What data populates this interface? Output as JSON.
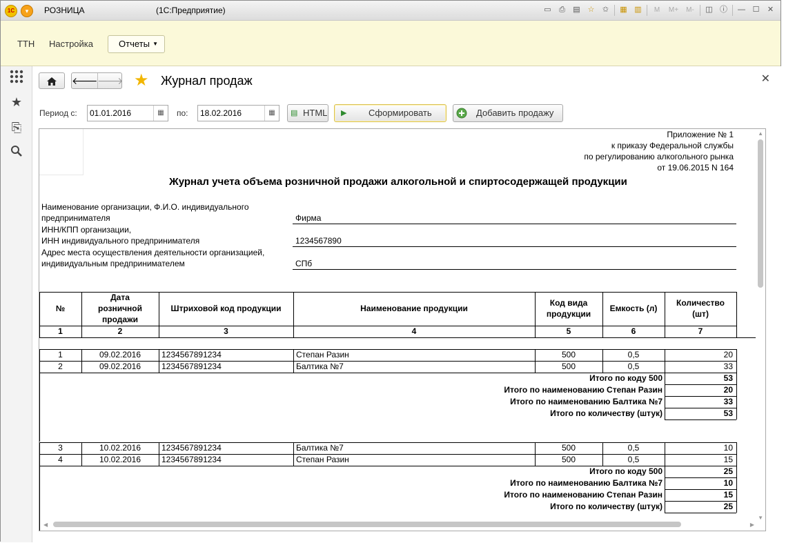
{
  "titlebar": {
    "app": "РОЗНИЦА",
    "subtitle": "(1С:Предприятие)",
    "icons": [
      "save-icon",
      "print-icon",
      "preview-icon",
      "favorites-add-icon",
      "favorites-icon",
      "calculator-icon",
      "calendar-icon",
      "memory-m-icon",
      "memory-mplus-icon",
      "memory-mminus-icon",
      "panel-icon",
      "info-icon",
      "minimize-icon",
      "maximize-icon",
      "close-icon"
    ],
    "icon_glyphs": [
      "▭",
      "⎙",
      "▤",
      "☆",
      "✩",
      "▦",
      "▥",
      "M",
      "M+",
      "M-",
      "◫",
      "ⓘ",
      "—",
      "☐",
      "✕"
    ]
  },
  "sections": {
    "ttn": "ТТН",
    "settings": "Настройка",
    "reports": "Отчеты"
  },
  "form": {
    "title": "Журнал продаж",
    "period_from_label": "Период с:",
    "period_from": "01.01.2016",
    "period_to_label": "по:",
    "period_to": "18.02.2016",
    "html_button": "HTML",
    "generate_button": "Сформировать",
    "add_sale_button": "Добавить продажу"
  },
  "report": {
    "appendix": [
      "Приложение № 1",
      "к приказу Федеральной службы",
      "по регулированию алкогольного рынка",
      "от 19.06.2015 N 164"
    ],
    "title": "Журнал учета объема розничной продажи алкогольной и спиртосодержащей продукции",
    "org_label_1": "Наименование организации, Ф.И.О. индивидуального",
    "org_label_2": "предпринимателя",
    "org_value": "Фирма",
    "inn_label_1": "ИНН/КПП организации,",
    "inn_label_2": "ИНН индивидуального предпринимателя",
    "inn_value": "1234567890",
    "addr_label_1": "Адрес места осуществления деятельности организацией,",
    "addr_label_2": "индивидуальным предпринимателем",
    "addr_value": "СПб",
    "columns": {
      "num": "№",
      "date_1": "Дата",
      "date_2": "розничной",
      "date_3": "продажи",
      "barcode": "Штриховой код продукции",
      "name": "Наименование продукции",
      "code_1": "Код вида",
      "code_2": "продукции",
      "volume": "Емкость (л)",
      "qty_1": "Количество",
      "qty_2": "(шт)"
    },
    "col_numbers": [
      "1",
      "2",
      "3",
      "4",
      "5",
      "6",
      "7"
    ],
    "groups": [
      {
        "rows": [
          {
            "n": "1",
            "date": "09.02.2016",
            "barcode": "1234567891234",
            "name": "Степан Разин",
            "code": "500",
            "vol": "0,5",
            "qty": "20"
          },
          {
            "n": "2",
            "date": "09.02.2016",
            "barcode": "1234567891234",
            "name": "Балтика №7",
            "code": "500",
            "vol": "0,5",
            "qty": "33"
          }
        ],
        "totals": [
          {
            "label": "Итого по коду 500",
            "value": "53"
          },
          {
            "label": "Итого по наименованию Степан Разин",
            "value": "20"
          },
          {
            "label": "Итого по наименованию Балтика №7",
            "value": "33"
          },
          {
            "label": "Итого по количеству (штук)",
            "value": "53"
          }
        ]
      },
      {
        "rows": [
          {
            "n": "3",
            "date": "10.02.2016",
            "barcode": "1234567891234",
            "name": "Балтика №7",
            "code": "500",
            "vol": "0,5",
            "qty": "10"
          },
          {
            "n": "4",
            "date": "10.02.2016",
            "barcode": "1234567891234",
            "name": "Степан Разин",
            "code": "500",
            "vol": "0,5",
            "qty": "15"
          }
        ],
        "totals": [
          {
            "label": "Итого по коду 500",
            "value": "25"
          },
          {
            "label": "Итого по наименованию Балтика №7",
            "value": "10"
          },
          {
            "label": "Итого по наименованию Степан Разин",
            "value": "15"
          },
          {
            "label": "Итого по количеству (штук)",
            "value": "25"
          }
        ]
      }
    ]
  }
}
